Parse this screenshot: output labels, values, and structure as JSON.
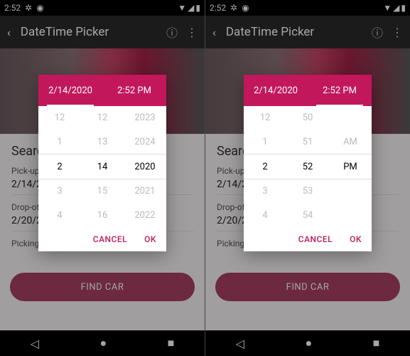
{
  "status": {
    "time": "2:52",
    "wifi": "▾",
    "signal": "◢",
    "batt": "▮"
  },
  "topbar": {
    "title": "DateTime Picker"
  },
  "search": {
    "heading": "Search",
    "pickup_label": "Pick-up date",
    "pickup_val": "2/14/2020",
    "dropoff_label": "Drop-off date",
    "dropoff_val": "2/20/2020",
    "picking": "Picking up"
  },
  "find": "FIND CAR",
  "picker": {
    "date_tab": "2/14/2020",
    "time_tab": "2:52 PM",
    "cancel": "CANCEL",
    "ok": "OK"
  },
  "left": {
    "c1": [
      "12",
      "1",
      "2",
      "3",
      "4"
    ],
    "c2": [
      "12",
      "13",
      "14",
      "15",
      "16"
    ],
    "c3": [
      "2023",
      "2024",
      "2020",
      "2021",
      "2022"
    ]
  },
  "right": {
    "c1": [
      "12",
      "1",
      "2",
      "3",
      "4"
    ],
    "c2": [
      "50",
      "51",
      "52",
      "53",
      "54"
    ],
    "c3": [
      "",
      "AM",
      "PM",
      "",
      ""
    ]
  }
}
